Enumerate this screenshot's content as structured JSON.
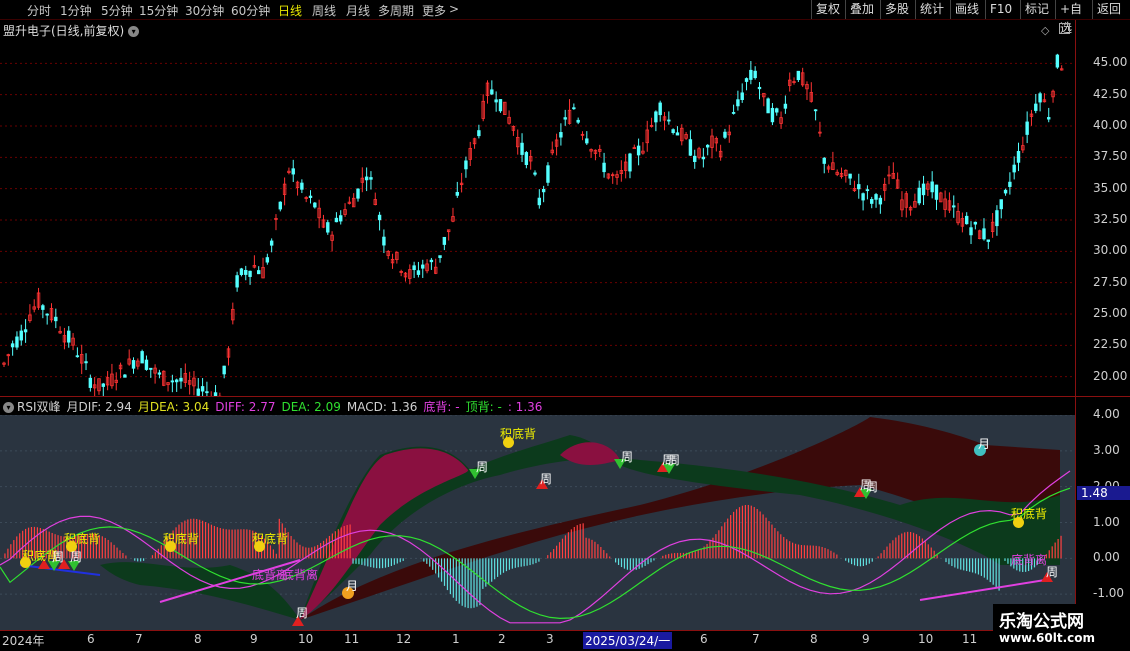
{
  "toolbar": {
    "periods": [
      "分时",
      "1分钟",
      "5分钟",
      "15分钟",
      "30分钟",
      "60分钟",
      "日线",
      "周线",
      "月线",
      "多周期",
      "更多"
    ],
    "active_period": "日线",
    "more_arrow": ">",
    "actions": [
      "复权",
      "叠加",
      "多股",
      "统计",
      "画线",
      "F10",
      "标记",
      "+自选",
      "返回"
    ]
  },
  "stock": {
    "title": "盟升电子(日线,前复权)"
  },
  "price_axis": {
    "ticks": [
      "45.00",
      "42.50",
      "40.00",
      "37.50",
      "35.00",
      "32.50",
      "30.00",
      "27.50",
      "25.00",
      "22.50",
      "20.00"
    ]
  },
  "indicator": {
    "legend": [
      {
        "text": "RSI双峰",
        "color": "#d0d0d0"
      },
      {
        "text": "月DIF: 2.94",
        "color": "#d0d0d0"
      },
      {
        "text": "月DEA: 3.04",
        "color": "#e0e020"
      },
      {
        "text": "DIFF: 2.77",
        "color": "#e040e0"
      },
      {
        "text": "DEA: 2.09",
        "color": "#30e030"
      },
      {
        "text": "MACD: 1.36",
        "color": "#d0d0d0"
      },
      {
        "text": "底背: -",
        "color": "#e040e0"
      },
      {
        "text": "顶背: -",
        "color": "#30e030"
      },
      {
        "text": ": 1.36",
        "color": "#e040e0"
      }
    ],
    "ticks": [
      "4.00",
      "3.00",
      "2.00",
      "1.00",
      "0.00",
      "-1.00"
    ],
    "current_value": "1.48",
    "notes": {
      "ji_di_bei": "积底背",
      "di_bei_li": "底背离",
      "zhou": "周",
      "yue": "月"
    }
  },
  "dates": [
    "2024年",
    "6",
    "7",
    "8",
    "9",
    "10",
    "11",
    "12",
    "1",
    "2",
    "3",
    "2025/03/24/一",
    "6",
    "7",
    "8",
    "9",
    "10",
    "11"
  ],
  "brand": {
    "name": "乐淘公式网",
    "url": "www.60lt.com"
  },
  "colors": {
    "up": "#ff3333",
    "down": "#54ffff",
    "axis": "#8a1010",
    "panel_bg": "#2a3440"
  },
  "chart_data": {
    "type": "candlestick",
    "price_ylim": [
      17.5,
      47.5
    ],
    "indicator_ylim": [
      -2.0,
      4.0
    ],
    "close_path": [
      21,
      22.5,
      23.4,
      25,
      26,
      25.2,
      24.6,
      23.4,
      22.6,
      21.4,
      19.8,
      19.2,
      19.4,
      20.2,
      20.6,
      21.3,
      21.6,
      20.7,
      20.0,
      19.8,
      19.7,
      19.6,
      19.2,
      19.0,
      18.6,
      18.4,
      22.0,
      27.6,
      28.5,
      28.8,
      28.4,
      30.5,
      33.5,
      36.6,
      35.4,
      34.2,
      33.7,
      32.0,
      31.5,
      32.9,
      33.7,
      34.8,
      36.4,
      34.4,
      31.0,
      29.7,
      28.9,
      28.1,
      28.5,
      29.0,
      28.8,
      30.8,
      32.5,
      35.6,
      37.8,
      39.8,
      42.8,
      42.6,
      41.2,
      40.0,
      38.0,
      37.2,
      34.0,
      36.2,
      38.6,
      40.2,
      41.5,
      39.8,
      38.6,
      37.5,
      36.2,
      35.6,
      36.6,
      37.6,
      38.4,
      40.0,
      41.6,
      40.4,
      39.6,
      38.8,
      37.7,
      37.5,
      38.6,
      38.2,
      39.8,
      41.6,
      43.5,
      44.2,
      42.0,
      41.0,
      40.5,
      43.6,
      44.2,
      43.0,
      41.0,
      37.4,
      36.5,
      36.0,
      35.7,
      35.0,
      34.4,
      34.0,
      34.9,
      36.2,
      34.0,
      33.9,
      34.5,
      34.9,
      34.8,
      33.8,
      33.2,
      32.5,
      32.0,
      31.5,
      31.2,
      32.6,
      34.3,
      36.7,
      38.6,
      40.9,
      42.6,
      41.0,
      45.0
    ]
  }
}
